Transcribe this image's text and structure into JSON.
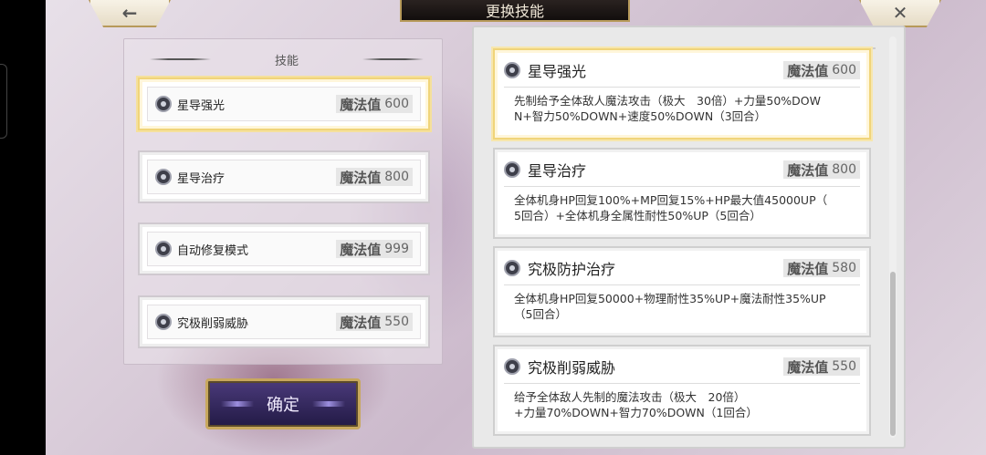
{
  "header": {
    "title": "更换技能",
    "back_icon": "←",
    "close_icon": "✕"
  },
  "left_panel": {
    "section_label": "技能",
    "slots": [
      {
        "name": "星导强光",
        "mp_label": "魔法值",
        "mp_value": "600",
        "selected": true
      },
      {
        "name": "星导治疗",
        "mp_label": "魔法值",
        "mp_value": "800",
        "selected": false
      },
      {
        "name": "自动修复模式",
        "mp_label": "魔法值",
        "mp_value": "999",
        "selected": false
      },
      {
        "name": "究极削弱威胁",
        "mp_label": "魔法值",
        "mp_value": "550",
        "selected": false
      }
    ]
  },
  "confirm_label": "确定",
  "skill_list": [
    {
      "name": "星导强光",
      "mp_label": "魔法值",
      "mp_value": "600",
      "selected": true,
      "desc_line1": "先制给予全体敌人魔法攻击（极大　30倍）+力量50%DOW",
      "desc_line2": "N+智力50%DOWN+速度50%DOWN（3回合）"
    },
    {
      "name": "星导治疗",
      "mp_label": "魔法值",
      "mp_value": "800",
      "selected": false,
      "desc_line1": "全体机身HP回复100%+MP回复15%+HP最大值45000UP（",
      "desc_line2": "5回合）+全体机身全属性耐性50%UP（5回合）"
    },
    {
      "name": "究极防护治疗",
      "mp_label": "魔法值",
      "mp_value": "580",
      "selected": false,
      "desc_line1": "全体机身HP回复50000+物理耐性35%UP+魔法耐性35%UP",
      "desc_line2": "（5回合）"
    },
    {
      "name": "究极削弱威胁",
      "mp_label": "魔法值",
      "mp_value": "550",
      "selected": false,
      "desc_line1": "给予全体敌人先制的魔法攻击（极大　20倍）",
      "desc_line2": "+力量70%DOWN+智力70%DOWN（1回合）"
    }
  ],
  "colors": {
    "selected_border": "#f0d47a",
    "title_bg": "#1a1412",
    "confirm_bg": "#342a5f"
  }
}
